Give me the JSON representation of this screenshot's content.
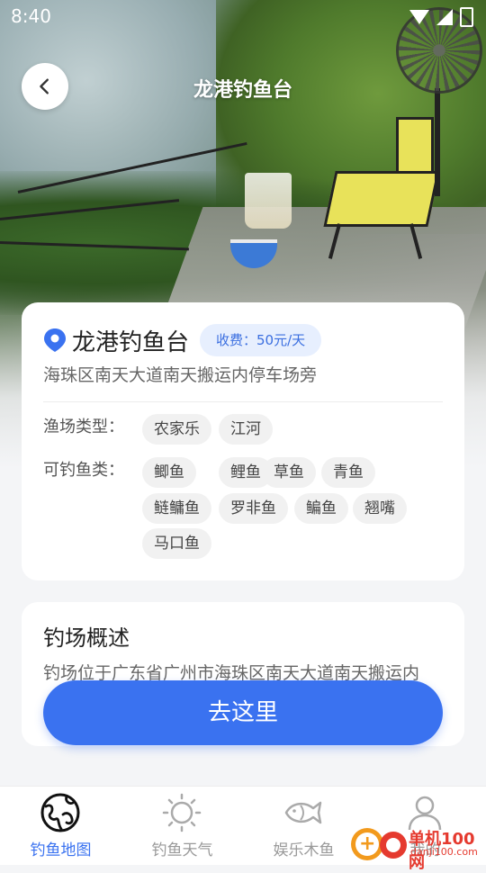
{
  "status_bar": {
    "time": "8:40"
  },
  "header": {
    "title": "龙港钓鱼台"
  },
  "spot": {
    "name": "龙港钓鱼台",
    "fee": "收费：50元/天",
    "address": "海珠区南天大道南天搬运内停车场旁",
    "type_label": "渔场类型：",
    "types": [
      "农家乐",
      "江河"
    ],
    "fish_label": "可钓鱼类：",
    "fish": [
      "鲫鱼",
      "鲤鱼",
      "草鱼",
      "青鱼",
      "鲢鳙鱼",
      "罗非鱼",
      "鳊鱼",
      "翘嘴",
      "马口鱼"
    ]
  },
  "overview": {
    "title": "钓场概述",
    "text": "钓场位于广东省广州市海珠区南天大道南天搬运内"
  },
  "go_button": {
    "label": "去这里"
  },
  "bottom_nav": {
    "items": [
      {
        "label": "钓鱼地图",
        "icon": "globe-icon",
        "active": true
      },
      {
        "label": "钓鱼天气",
        "icon": "sun-icon",
        "active": false
      },
      {
        "label": "娱乐木鱼",
        "icon": "fish-icon",
        "active": false
      },
      {
        "label": "我的",
        "icon": "user-icon",
        "active": false
      }
    ]
  },
  "watermark": {
    "text": "单机100网",
    "url_text": "danji100.com"
  },
  "colors": {
    "accent": "#3a72f0",
    "badge_bg": "#e7effe",
    "tag_bg": "#f1f1f1"
  }
}
